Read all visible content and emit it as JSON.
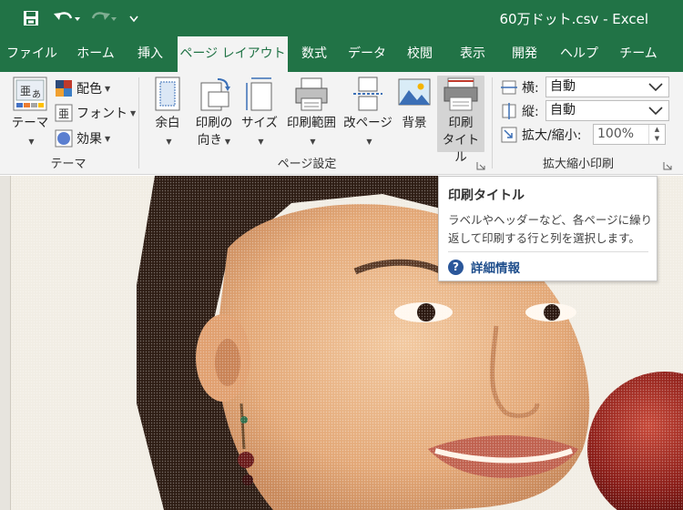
{
  "window": {
    "title": "60万ドット.csv  -  Excel"
  },
  "tabs": [
    {
      "label": "ファイル"
    },
    {
      "label": "ホーム"
    },
    {
      "label": "挿入"
    },
    {
      "label": "ページ レイアウト"
    },
    {
      "label": "数式"
    },
    {
      "label": "データ"
    },
    {
      "label": "校閲"
    },
    {
      "label": "表示"
    },
    {
      "label": "開発"
    },
    {
      "label": "ヘルプ"
    },
    {
      "label": "チーム"
    }
  ],
  "ribbon": {
    "themes": {
      "group_label": "テーマ",
      "theme_button": "テーマ",
      "colors": "配色",
      "fonts": "フォント",
      "effects": "効果"
    },
    "page_setup": {
      "group_label": "ページ設定",
      "margins": "余白",
      "orientation_line1": "印刷の",
      "orientation_line2": "向き",
      "size": "サイズ",
      "print_area": "印刷範囲",
      "breaks": "改ページ",
      "background": "背景",
      "print_titles_line1": "印刷",
      "print_titles_line2": "タイトル"
    },
    "scale": {
      "group_label": "拡大縮小印刷",
      "width_label": "横:",
      "width_value": "自動",
      "height_label": "縦:",
      "height_value": "自動",
      "scale_label": "拡大/縮小:",
      "scale_value": "100%"
    }
  },
  "tooltip": {
    "title": "印刷タイトル",
    "description": "ラベルやヘッダーなど、各ページに繰り返して印刷する行と列を選択します。",
    "help_link": "詳細情報"
  },
  "colors": {
    "excel_green": "#217346",
    "ribbon_bg": "#f3f3f3",
    "link_blue": "#1f4e8c"
  }
}
